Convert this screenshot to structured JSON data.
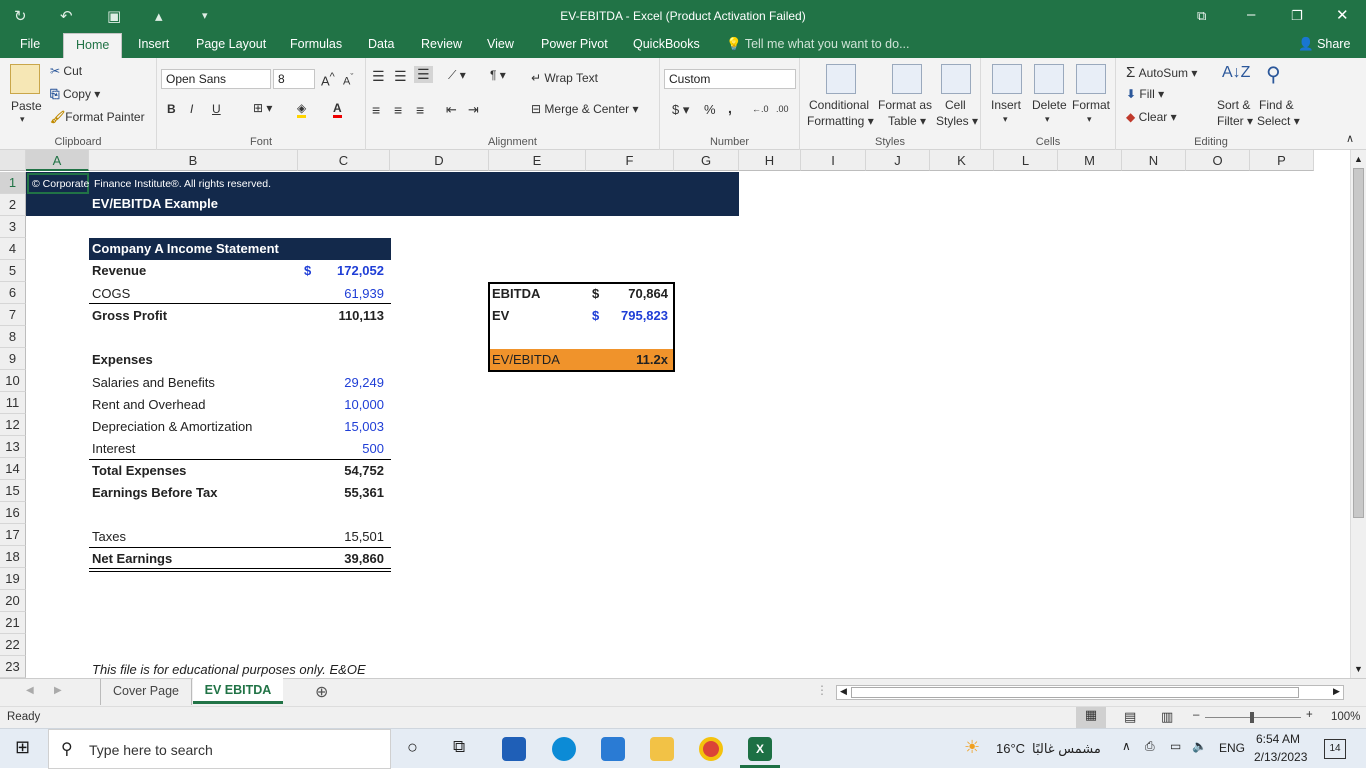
{
  "window": {
    "title": "EV-EBITDA - Excel (Product Activation Failed)"
  },
  "menu_tabs": [
    "File",
    "Home",
    "Insert",
    "Page Layout",
    "Formulas",
    "Data",
    "Review",
    "View",
    "Power Pivot",
    "QuickBooks"
  ],
  "tell_me": "Tell me what you want to do...",
  "share": "Share",
  "ribbon": {
    "clipboard": {
      "paste": "Paste",
      "cut": "Cut",
      "copy": "Copy",
      "format_painter": "Format Painter",
      "label": "Clipboard"
    },
    "font": {
      "family": "Open Sans",
      "size": "8",
      "label": "Font",
      "bold": "B",
      "italic": "I",
      "underline": "U"
    },
    "alignment": {
      "wrap": "Wrap Text",
      "merge": "Merge & Center",
      "label": "Alignment"
    },
    "number": {
      "format": "Custom",
      "label": "Number",
      "currency": "$",
      "percent": "%",
      "comma": ","
    },
    "styles": {
      "conditional": "Conditional",
      "conditional2": "Formatting",
      "format_as": "Format as",
      "format_as2": "Table",
      "cell": "Cell",
      "cell2": "Styles",
      "label": "Styles"
    },
    "cells": {
      "insert": "Insert",
      "delete": "Delete",
      "format": "Format",
      "label": "Cells"
    },
    "editing": {
      "autosum": "AutoSum",
      "fill": "Fill",
      "clear": "Clear",
      "sort": "Sort &",
      "sort2": "Filter",
      "find": "Find &",
      "find2": "Select",
      "label": "Editing"
    }
  },
  "columns": [
    "A",
    "B",
    "C",
    "D",
    "E",
    "F",
    "G",
    "H",
    "I",
    "J",
    "K",
    "L",
    "M",
    "N",
    "O",
    "P"
  ],
  "rows": [
    "1",
    "2",
    "3",
    "4",
    "5",
    "6",
    "7",
    "8",
    "9",
    "10",
    "11",
    "12",
    "13",
    "14",
    "15",
    "16",
    "17",
    "18",
    "19",
    "20",
    "21",
    "22",
    "23"
  ],
  "sheet": {
    "a1": "© Corporate",
    "a1_rest": "Finance Institute®. All rights reserved.",
    "title": "EV/EBITDA Example",
    "income_header": "Company A Income Statement",
    "revenue": "Revenue",
    "dollar": "$",
    "revenue_val": "172,052",
    "cogs": "COGS",
    "cogs_val": "61,939",
    "gross": "Gross Profit",
    "gross_val": "110,113",
    "expenses": "Expenses",
    "salaries": "Salaries and Benefits",
    "salaries_val": "29,249",
    "rent": "Rent and Overhead",
    "rent_val": "10,000",
    "da": "Depreciation & Amortization",
    "da_val": "15,003",
    "interest": "Interest",
    "interest_val": "500",
    "total_exp": "Total Expenses",
    "total_exp_val": "54,752",
    "ebt": "Earnings Before Tax",
    "ebt_val": "55,361",
    "taxes": "Taxes",
    "taxes_val": "15,501",
    "net": "Net Earnings",
    "net_val": "39,860",
    "ebitda": "EBITDA",
    "ebitda_val": "70,864",
    "ev": "EV",
    "ev_val": "795,823",
    "ratio": "EV/EBITDA",
    "ratio_val": "11.2x",
    "disclaimer": "This file is for educational purposes only. E&OE"
  },
  "sheet_tabs": [
    "Cover Page",
    "EV EBITDA"
  ],
  "status": {
    "ready": "Ready",
    "zoom": "100%"
  },
  "taskbar": {
    "search": "Type here to search",
    "weather": "16°C",
    "weather_text": "مشمس غالبًا",
    "lang": "ENG",
    "time": "6:54 AM",
    "date": "2/13/2023",
    "badge": "14"
  },
  "colors": {
    "excel_green": "#217346",
    "navy": "#13294b",
    "orange": "#f0932b",
    "input_blue": "#1f3ed6"
  }
}
